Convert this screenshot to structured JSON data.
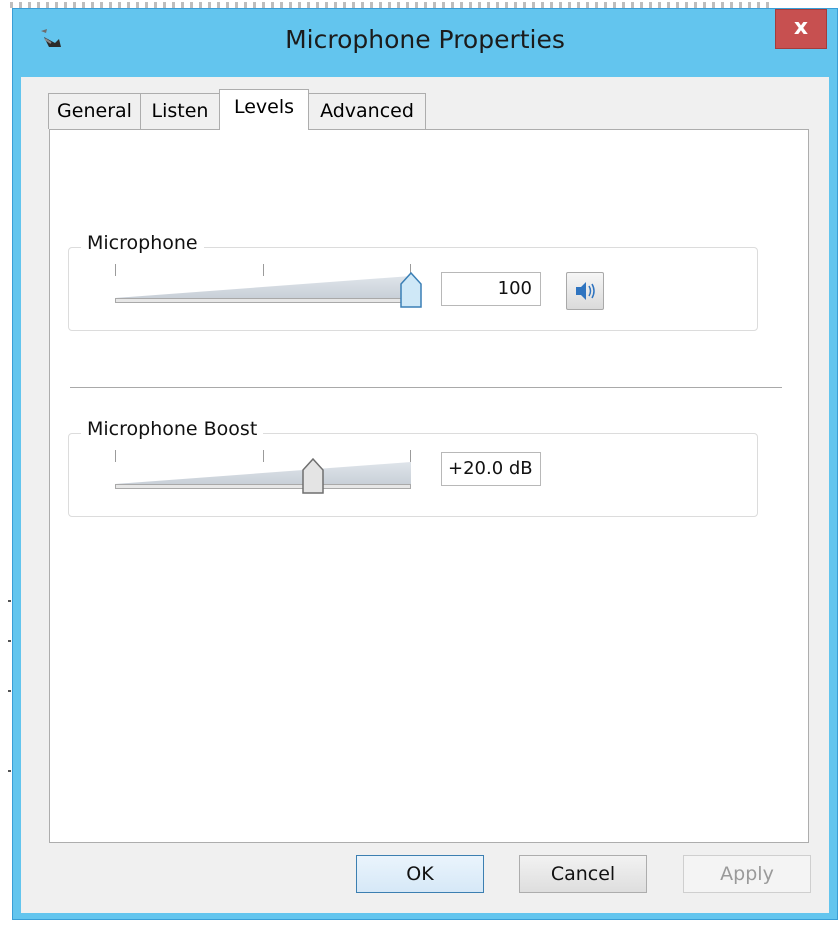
{
  "window": {
    "title": "Microphone Properties",
    "close_label": "x"
  },
  "tabs": [
    {
      "label": "General",
      "active": false
    },
    {
      "label": "Listen",
      "active": false
    },
    {
      "label": "Levels",
      "active": true
    },
    {
      "label": "Advanced",
      "active": false
    }
  ],
  "levels": {
    "microphone": {
      "label": "Microphone",
      "value_text": "100",
      "level_fraction": 1.0,
      "mute_icon": "speaker-icon"
    },
    "boost": {
      "label": "Microphone Boost",
      "value_text": "+20.0 dB",
      "level_fraction": 0.67
    }
  },
  "buttons": {
    "ok": "OK",
    "cancel": "Cancel",
    "apply": "Apply"
  },
  "colors": {
    "titlebar": "#63c5ee",
    "close": "#c75050",
    "thumb_active": "#cfe8f7"
  }
}
